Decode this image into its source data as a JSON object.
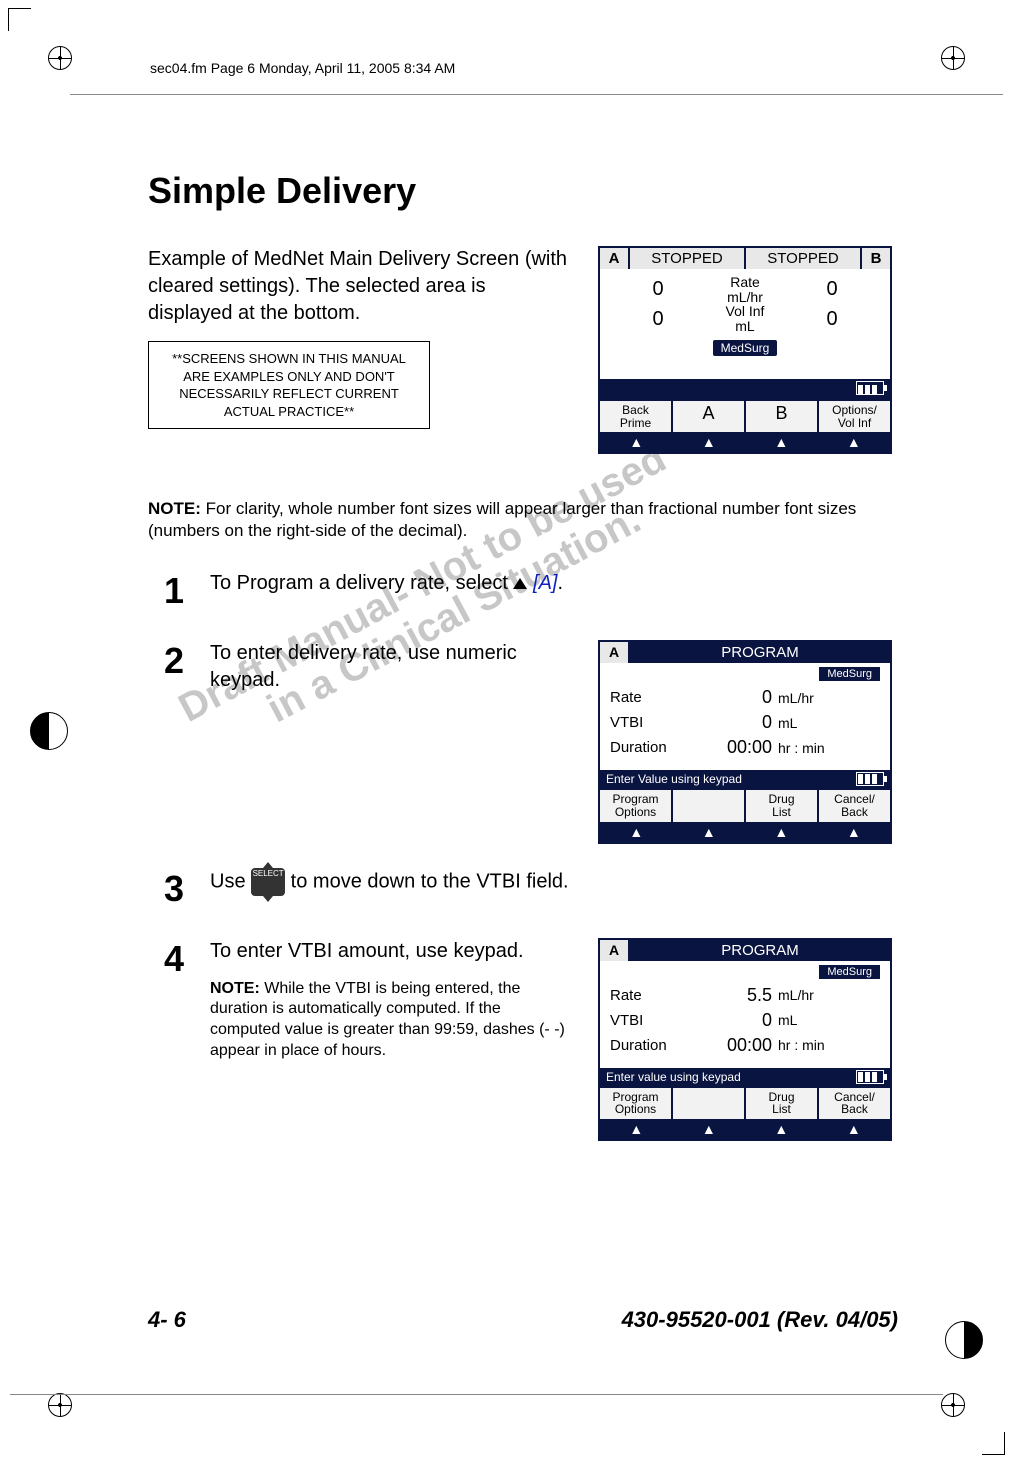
{
  "header_line": "sec04.fm  Page 6  Monday, April 11, 2005  8:34 AM",
  "title": "Simple Delivery",
  "intro": "Example of MedNet Main Delivery Screen (with cleared settings). The selected area is displayed at the bottom.",
  "disclaimer": "**SCREENS SHOWN IN THIS MANUAL ARE EXAMPLES ONLY AND DON'T NECESSARILY REFLECT CURRENT ACTUAL PRACTICE**",
  "note1_label": "NOTE:",
  "note1_text": " For clarity, whole number font sizes will appear larger than fractional number font sizes (numbers on the right-side of the decimal).",
  "steps": {
    "s1_num": "1",
    "s1_text_a": "To Program a delivery rate, select ",
    "s1_ref": "[A]",
    "s1_text_b": ".",
    "s2_num": "2",
    "s2_text": "To enter delivery rate, use numeric keypad.",
    "s3_num": "3",
    "s3_text_a": "Use ",
    "s3_select": "SELECT",
    "s3_text_b": " to move down to the VTBI field.",
    "s4_num": "4",
    "s4_text": "To enter VTBI amount, use keypad.",
    "s4_note_label": "NOTE:",
    "s4_note_text": " While the VTBI is being entered, the duration is automatically computed. If the computed value is greater than 99:59, dashes (- -) appear in place of hours."
  },
  "pump1": {
    "a": "A",
    "b": "B",
    "stopped_l": "STOPPED",
    "stopped_r": "STOPPED",
    "rate_l": "0",
    "rate_lbl": "Rate",
    "rate_unit": "mL/hr",
    "rate_r": "0",
    "vol_l": "0",
    "vol_lbl": "Vol Inf",
    "vol_unit": "mL",
    "vol_r": "0",
    "medsurg": "MedSurg",
    "sk1": "Back\nPrime",
    "sk2": "A",
    "sk3": "B",
    "sk4": "Options/\nVol Inf"
  },
  "pump2": {
    "a": "A",
    "title": "PROGRAM",
    "medsurg": "MedSurg",
    "rate_lbl": "Rate",
    "rate_val": "0",
    "rate_unit": "mL/hr",
    "vtbi_lbl": "VTBI",
    "vtbi_val": "0",
    "vtbi_unit": "mL",
    "dur_lbl": "Duration",
    "dur_val": "00:00",
    "dur_unit": "hr : min",
    "enter": "Enter Value using keypad",
    "sk1": "Program\nOptions",
    "sk2": "",
    "sk3": "Drug\nList",
    "sk4": "Cancel/\nBack"
  },
  "pump3": {
    "a": "A",
    "title": "PROGRAM",
    "medsurg": "MedSurg",
    "rate_lbl": "Rate",
    "rate_val": "5.5",
    "rate_unit": "mL/hr",
    "vtbi_lbl": "VTBI",
    "vtbi_val": "0",
    "vtbi_unit": "mL",
    "dur_lbl": "Duration",
    "dur_val": "00:00",
    "dur_unit": "hr : min",
    "enter": "Enter value using keypad",
    "sk1": "Program\nOptions",
    "sk2": "",
    "sk3": "Drug\nList",
    "sk4": "Cancel/\nBack"
  },
  "watermark": "Draft Manual- Not to be used\n       in a Clinical Situation.",
  "footer_left": "4- 6",
  "footer_right": "430-95520-001 (Rev. 04/05)"
}
